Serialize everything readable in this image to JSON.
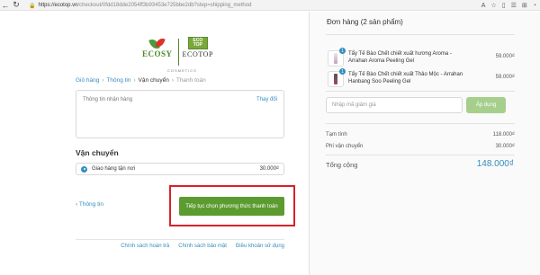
{
  "browser": {
    "url_host": "https://ecotop.vn",
    "url_path": "/checkout/0fdd18dde2054ff3b93453e725bbe2db?step=shipping_method"
  },
  "logo": {
    "ecosy": "ECOSY",
    "badge_top": "ECO",
    "badge_bottom": "TOP",
    "ecotop": "ECOTOP",
    "tagline": "COSMETICS"
  },
  "breadcrumb": {
    "cart": "Giỏ hàng",
    "info": "Thông tin",
    "shipping": "Vận chuyển",
    "payment": "Thanh toán",
    "separator": "›"
  },
  "address": {
    "label": "Thông tin nhận hàng",
    "change": "Thay đổi"
  },
  "shipping": {
    "title": "Vận chuyển",
    "method": "Giao hàng tận nơi",
    "price": "30.000₫"
  },
  "actions": {
    "back": "‹ Thông tin",
    "continue": "Tiếp tục chọn phương thức thanh toán"
  },
  "footer": {
    "refund": "Chính sách hoàn trả",
    "privacy": "Chính sách bảo mật",
    "terms": "Điều khoản sử dụng"
  },
  "order": {
    "title": "Đơn hàng (2 sản phẩm)",
    "products": [
      {
        "qty": "1",
        "name": "Tẩy Tế Bào Chết chiết xuất hương Aroma - Arrahan Aroma Peeling Gel",
        "price": "59.000₫"
      },
      {
        "qty": "1",
        "name": "Tẩy Tế Bào Chết chiết xuất Thảo Mộc - Arrahan Hanbang Soo Peeling Gel",
        "price": "59.000₫"
      }
    ],
    "coupon_placeholder": "Nhập mã giảm giá",
    "apply": "Áp dụng",
    "subtotal_label": "Tạm tính",
    "subtotal": "118.000₫",
    "shipping_label": "Phí vận chuyển",
    "shipping_fee": "30.000₫",
    "total_label": "Tổng cộng",
    "total": "148.000₫"
  },
  "colors": {
    "accent": "#338dbc",
    "primary_button": "#5c9b30",
    "highlight": "#d7222a"
  }
}
